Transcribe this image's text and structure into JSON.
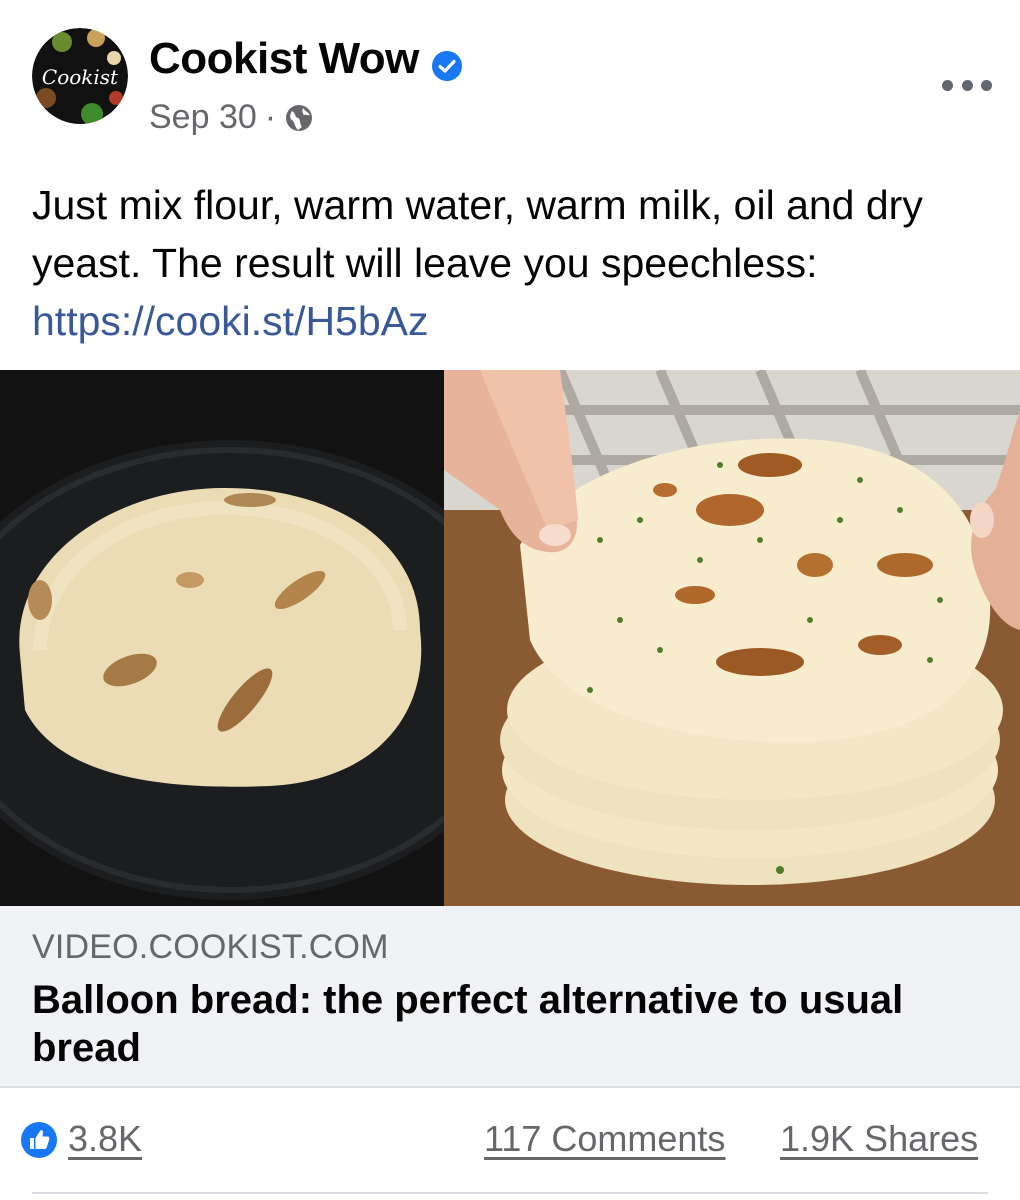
{
  "post": {
    "page_name": "Cookist Wow",
    "avatar_text": "Cookist",
    "date": "Sep 30",
    "separator": "·",
    "message_text": "Just mix flour, warm water, warm milk, oil and dry yeast. The result will leave you speechless: ",
    "message_link": "https://cooki.st/H5bAz"
  },
  "link_preview": {
    "domain": "VIDEO.COOKIST.COM",
    "title": "Balloon bread: the perfect alternative to usual bread"
  },
  "footer": {
    "likes": "3.8K",
    "comments": "117 Comments",
    "shares": "1.9K Shares"
  },
  "icons": {
    "verified": "verified-badge-icon",
    "audience": "globe-icon",
    "more": "more-options-icon",
    "reaction": "like-thumb-icon"
  },
  "colors": {
    "link": "#385898",
    "verified": "#1877f2",
    "secondary_text": "#65676b",
    "card_background": "#f0f2f5"
  }
}
